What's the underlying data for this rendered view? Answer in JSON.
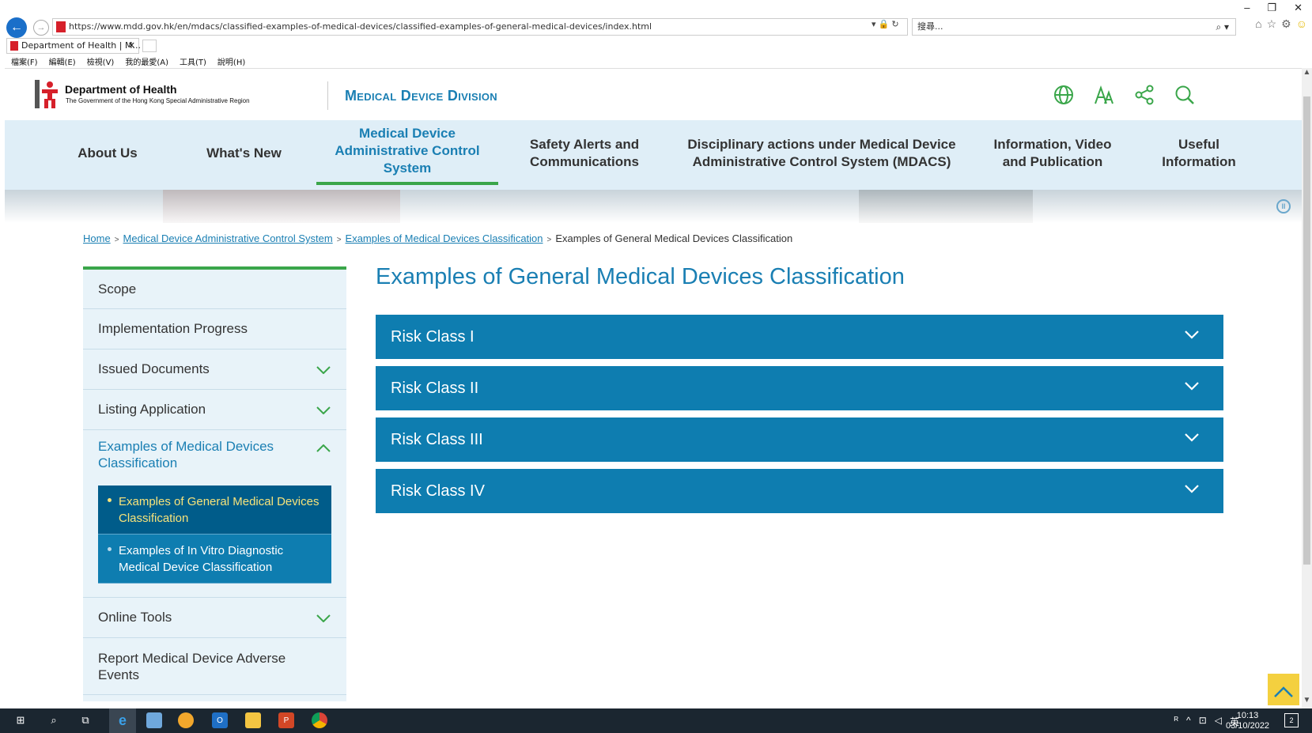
{
  "browser": {
    "url": "https://www.mdd.gov.hk/en/mdacs/classified-examples-of-medical-devices/classified-examples-of-general-medical-devices/index.html",
    "search_placeholder": "搜尋...",
    "tab_title": "Department of Health | M...",
    "menu": [
      "檔案(F)",
      "編輯(E)",
      "檢視(V)",
      "我的最愛(A)",
      "工具(T)",
      "說明(H)"
    ]
  },
  "header": {
    "dept_name": "Department of Health",
    "dept_sub": "The Government of the Hong Kong Special Administrative Region",
    "division": "Medical Device Division",
    "icons": [
      "globe-icon",
      "font-size-icon",
      "share-icon",
      "search-icon"
    ]
  },
  "nav": [
    "About Us",
    "What's New",
    "Medical Device Administrative Control System",
    "Safety Alerts and Communications",
    "Disciplinary actions under Medical Device Administrative Control System (MDACS)",
    "Information, Video and Publication",
    "Useful Information"
  ],
  "breadcrumb": [
    "Home",
    "Medical Device Administrative Control System",
    "Examples of Medical Devices Classification",
    "Examples of General Medical Devices Classification"
  ],
  "sidebar": {
    "items": [
      "Scope",
      "Implementation Progress",
      "Issued Documents",
      "Listing Application",
      "Examples of Medical Devices Classification",
      "Online Tools",
      "Report Medical Device Adverse Events"
    ],
    "subitems": [
      "Examples of General Medical Devices Classification",
      "Examples of In Vitro Diagnostic Medical Device Classification"
    ]
  },
  "main": {
    "title": "Examples of General Medical Devices Classification",
    "accordion": [
      "Risk Class I",
      "Risk Class II",
      "Risk Class III",
      "Risk Class IV"
    ]
  },
  "taskbar": {
    "time": "10:13",
    "date": "03/10/2022",
    "ime": "英",
    "notifications": "2"
  },
  "colors": {
    "brand_blue": "#1a7fb3",
    "accent_green": "#3aa64a",
    "accordion_bg": "#0e7db0",
    "active_sub_bg": "#005c8a",
    "active_sub_text": "#f7e37a",
    "nav_bg": "#dfeef7"
  }
}
